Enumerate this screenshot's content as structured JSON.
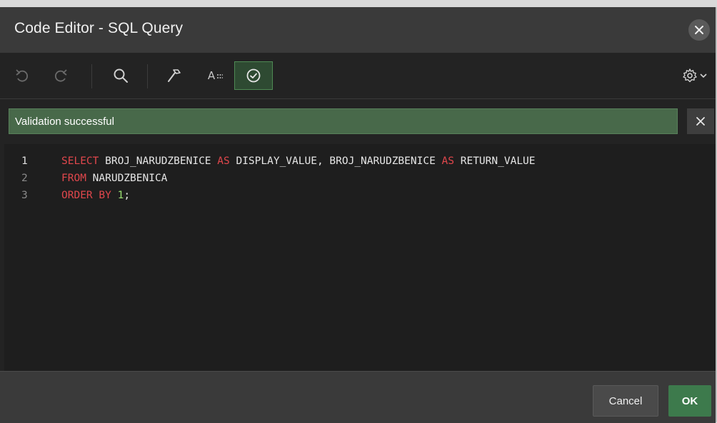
{
  "dialog": {
    "title": "Code Editor - SQL Query",
    "close_icon": "close-icon"
  },
  "toolbar": {
    "undo_icon": "undo-icon",
    "redo_icon": "redo-icon",
    "search_icon": "search-icon",
    "format_icon": "hammer-icon",
    "font_label": "A",
    "validate_icon": "check-circle-icon",
    "settings_icon": "gear-icon",
    "settings_chevron": "chevron-down-icon"
  },
  "banner": {
    "message": "Validation successful",
    "status_color": "#48694a"
  },
  "editor": {
    "lines": [
      {
        "number": "1",
        "tokens": [
          {
            "t": "SELECT",
            "k": "kw"
          },
          {
            "t": " BROJ_NARUDZBENICE ",
            "k": "id"
          },
          {
            "t": "AS",
            "k": "kw"
          },
          {
            "t": " DISPLAY_VALUE, BROJ_NARUDZBENICE ",
            "k": "id"
          },
          {
            "t": "AS",
            "k": "kw"
          },
          {
            "t": " RETURN_VALUE",
            "k": "id"
          }
        ]
      },
      {
        "number": "2",
        "tokens": [
          {
            "t": "FROM",
            "k": "kw"
          },
          {
            "t": " NARUDZBENICA",
            "k": "id"
          }
        ]
      },
      {
        "number": "3",
        "tokens": [
          {
            "t": "ORDER BY",
            "k": "kw"
          },
          {
            "t": " ",
            "k": "id"
          },
          {
            "t": "1",
            "k": "num"
          },
          {
            "t": ";",
            "k": "id"
          }
        ]
      }
    ]
  },
  "footer": {
    "cancel_label": "Cancel",
    "ok_label": "OK",
    "ok_color": "#3d7a4c"
  }
}
